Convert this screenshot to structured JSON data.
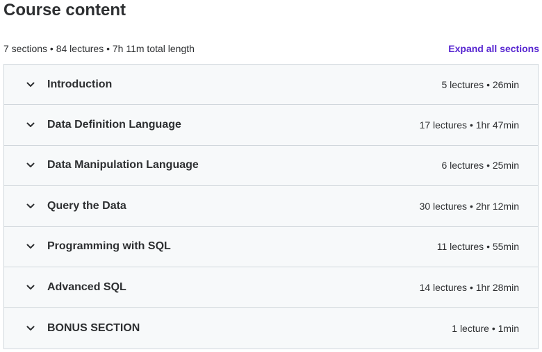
{
  "header": {
    "title": "Course content",
    "summary": "7 sections • 84 lectures • 7h 11m total length",
    "expand_label": "Expand all sections"
  },
  "sections": [
    {
      "title": "Introduction",
      "meta": "5 lectures • 26min",
      "icon": "chevron-down-icon"
    },
    {
      "title": "Data Definition Language",
      "meta": "17 lectures • 1hr 47min",
      "icon": "chevron-down-icon"
    },
    {
      "title": "Data Manipulation Language",
      "meta": "6 lectures • 25min",
      "icon": "chevron-down-icon"
    },
    {
      "title": "Query the Data",
      "meta": "30 lectures • 2hr 12min",
      "icon": "chevron-down-icon"
    },
    {
      "title": "Programming with SQL",
      "meta": "11 lectures • 55min",
      "icon": "chevron-down-icon"
    },
    {
      "title": "Advanced SQL",
      "meta": "14 lectures • 1hr 28min",
      "icon": "chevron-down-icon"
    },
    {
      "title": "BONUS SECTION",
      "meta": "1 lecture • 1min",
      "icon": "chevron-down-icon"
    }
  ],
  "colors": {
    "text": "#2d2f31",
    "accent": "#5624d0",
    "section_bg": "#f7f9fa",
    "border": "#d1d7dc"
  }
}
